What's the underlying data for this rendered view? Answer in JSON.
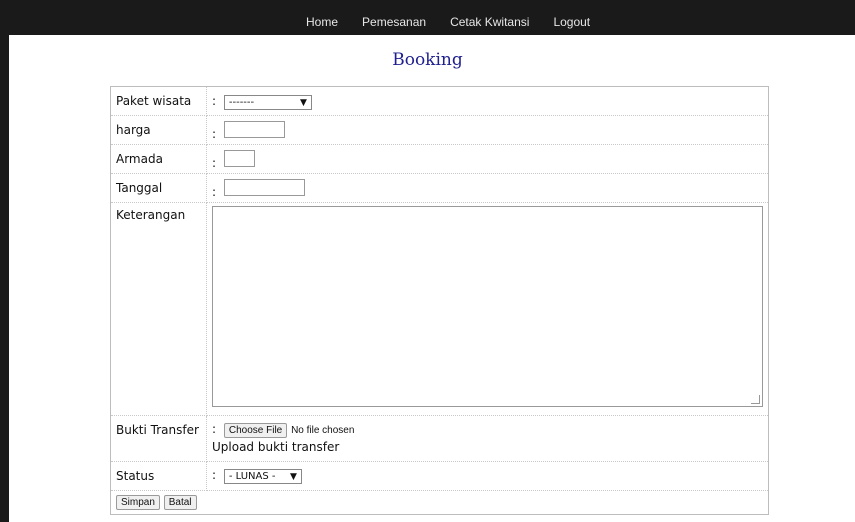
{
  "nav": {
    "items": [
      "Home",
      "Pemesanan",
      "Cetak Kwitansi",
      "Logout"
    ]
  },
  "page": {
    "title": "Booking"
  },
  "form": {
    "colon": ":",
    "paket": {
      "label": "Paket wisata",
      "value": "-------"
    },
    "harga": {
      "label": "harga",
      "value": ""
    },
    "armada": {
      "label": "Armada",
      "value": ""
    },
    "tanggal": {
      "label": "Tanggal",
      "value": ""
    },
    "keterangan": {
      "label": "Keterangan",
      "value": ""
    },
    "bukti": {
      "label": "Bukti Transfer",
      "choose_label": "Choose File",
      "file_status": "No file chosen",
      "hint": "Upload bukti transfer"
    },
    "status": {
      "label": "Status",
      "value": "- LUNAS -"
    },
    "buttons": {
      "save": "Simpan",
      "cancel": "Batal"
    }
  },
  "colors": {
    "topbar": "#1a1a1a",
    "title": "#1f1f8f"
  }
}
